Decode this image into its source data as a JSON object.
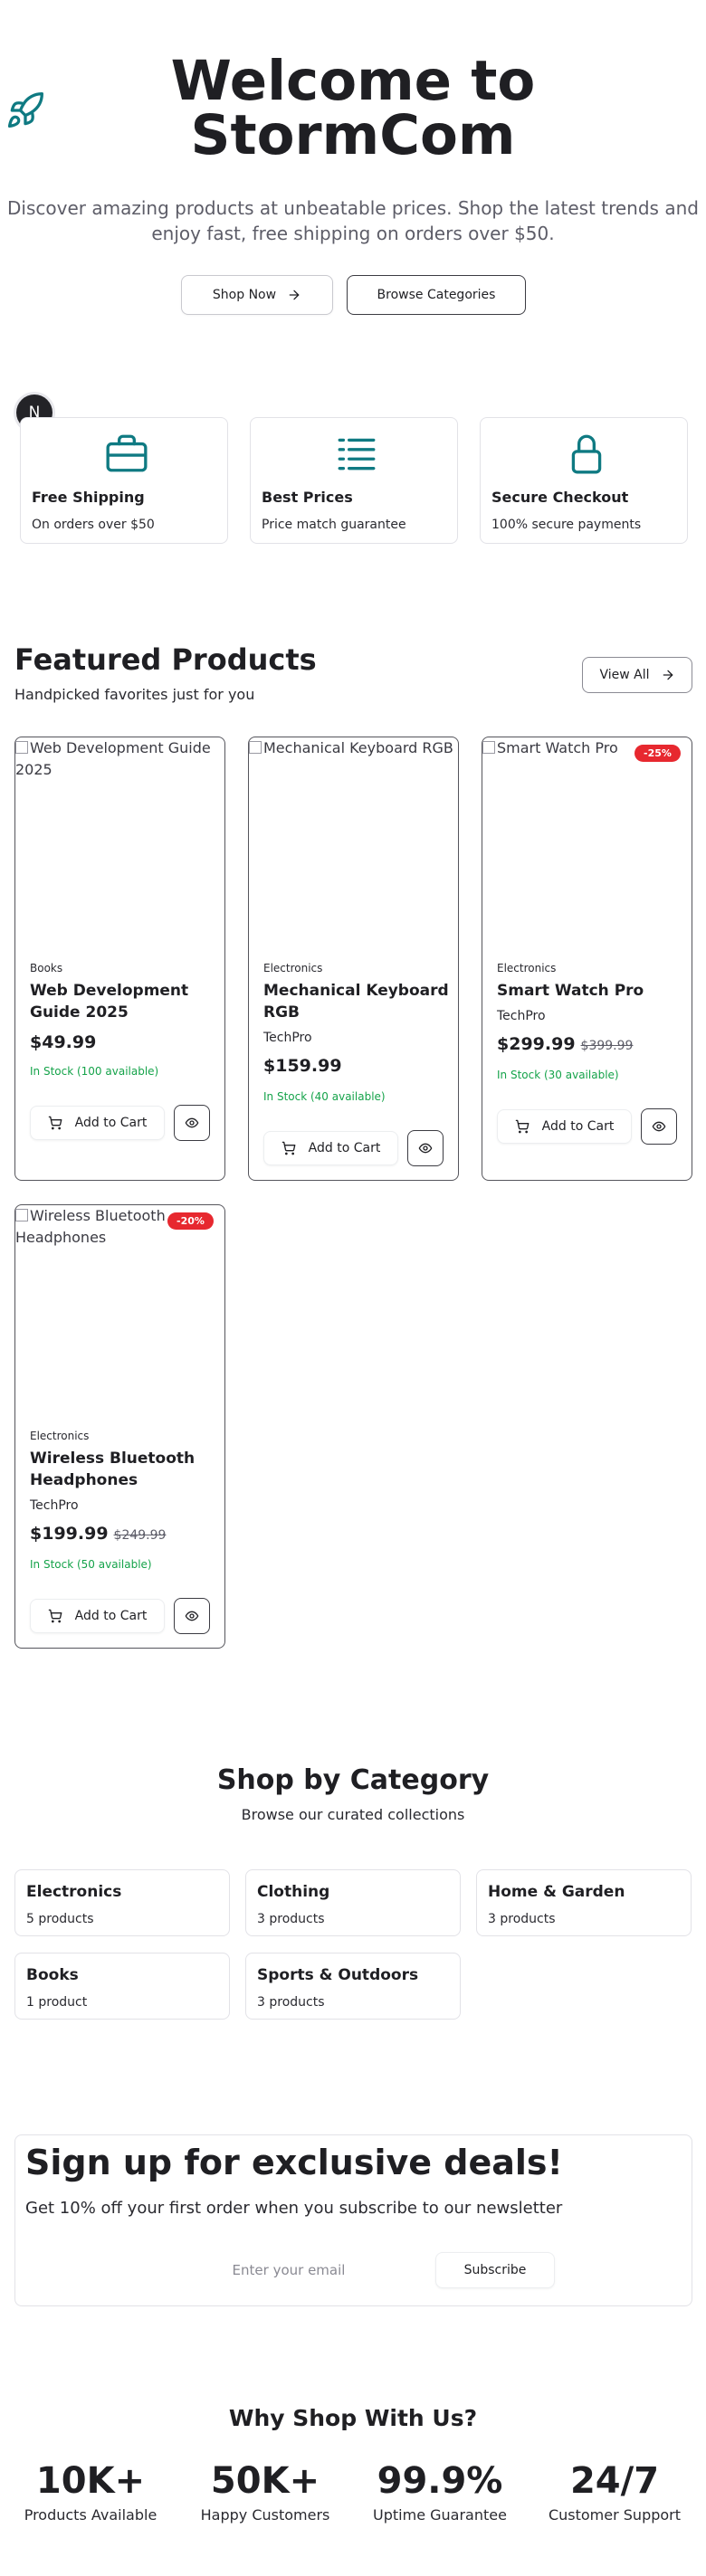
{
  "hero": {
    "title": "Welcome to StormCom",
    "subtitle": "Discover amazing products at unbeatable prices. Shop the latest trends and enjoy fast, free shipping on orders over $50.",
    "shop_now_label": "Shop Now",
    "browse_label": "Browse Categories",
    "icon": "rocket-icon"
  },
  "badge": {
    "letter": "N"
  },
  "features": [
    {
      "title": "Free Shipping",
      "subtitle": "On orders over $50",
      "icon": "briefcase-icon"
    },
    {
      "title": "Best Prices",
      "subtitle": "Price match guarantee",
      "icon": "list-icon"
    },
    {
      "title": "Secure Checkout",
      "subtitle": "100% secure payments",
      "icon": "lock-icon"
    }
  ],
  "featured": {
    "title": "Featured Products",
    "subtitle": "Handpicked favorites just for you",
    "view_all_label": "View All",
    "add_to_cart_label": "Add to Cart",
    "products": [
      {
        "image_alt": "Web Development Guide 2025",
        "category": "Books",
        "name": "Web Development Guide 2025",
        "brand": "",
        "price": "$49.99",
        "old_price": "",
        "discount": "",
        "stock": "In Stock (100 available)"
      },
      {
        "image_alt": "Mechanical Keyboard RGB",
        "category": "Electronics",
        "name": "Mechanical Keyboard RGB",
        "brand": "TechPro",
        "price": "$159.99",
        "old_price": "",
        "discount": "",
        "stock": "In Stock (40 available)"
      },
      {
        "image_alt": "Smart Watch Pro",
        "category": "Electronics",
        "name": "Smart Watch Pro",
        "brand": "TechPro",
        "price": "$299.99",
        "old_price": "$399.99",
        "discount": "-25%",
        "stock": "In Stock (30 available)"
      },
      {
        "image_alt": "Wireless Bluetooth Headphones",
        "category": "Electronics",
        "name": "Wireless Bluetooth Headphones",
        "brand": "TechPro",
        "price": "$199.99",
        "old_price": "$249.99",
        "discount": "-20%",
        "stock": "In Stock (50 available)"
      }
    ]
  },
  "categories": {
    "title": "Shop by Category",
    "subtitle": "Browse our curated collections",
    "items": [
      {
        "name": "Electronics",
        "count": "5 products"
      },
      {
        "name": "Clothing",
        "count": "3 products"
      },
      {
        "name": "Home & Garden",
        "count": "3 products"
      },
      {
        "name": "Books",
        "count": "1 product"
      },
      {
        "name": "Sports & Outdoors",
        "count": "3 products"
      }
    ]
  },
  "newsletter": {
    "title": "Sign up for exclusive deals!",
    "subtitle": "Get 10% off your first order when you subscribe to our newsletter",
    "email_placeholder": "Enter your email",
    "email_value": "",
    "subscribe_label": "Subscribe"
  },
  "why": {
    "title": "Why Shop With Us?",
    "stats": [
      {
        "value": "10K+",
        "label": "Products Available"
      },
      {
        "value": "50K+",
        "label": "Happy Customers"
      },
      {
        "value": "99.9%",
        "label": "Uptime Guarantee"
      },
      {
        "value": "24/7",
        "label": "Customer Support"
      }
    ]
  },
  "colors": {
    "accent_teal": "#0f7a82",
    "discount_red": "#e7282f",
    "stock_green": "#15a34a",
    "text": "#1f1f23"
  }
}
